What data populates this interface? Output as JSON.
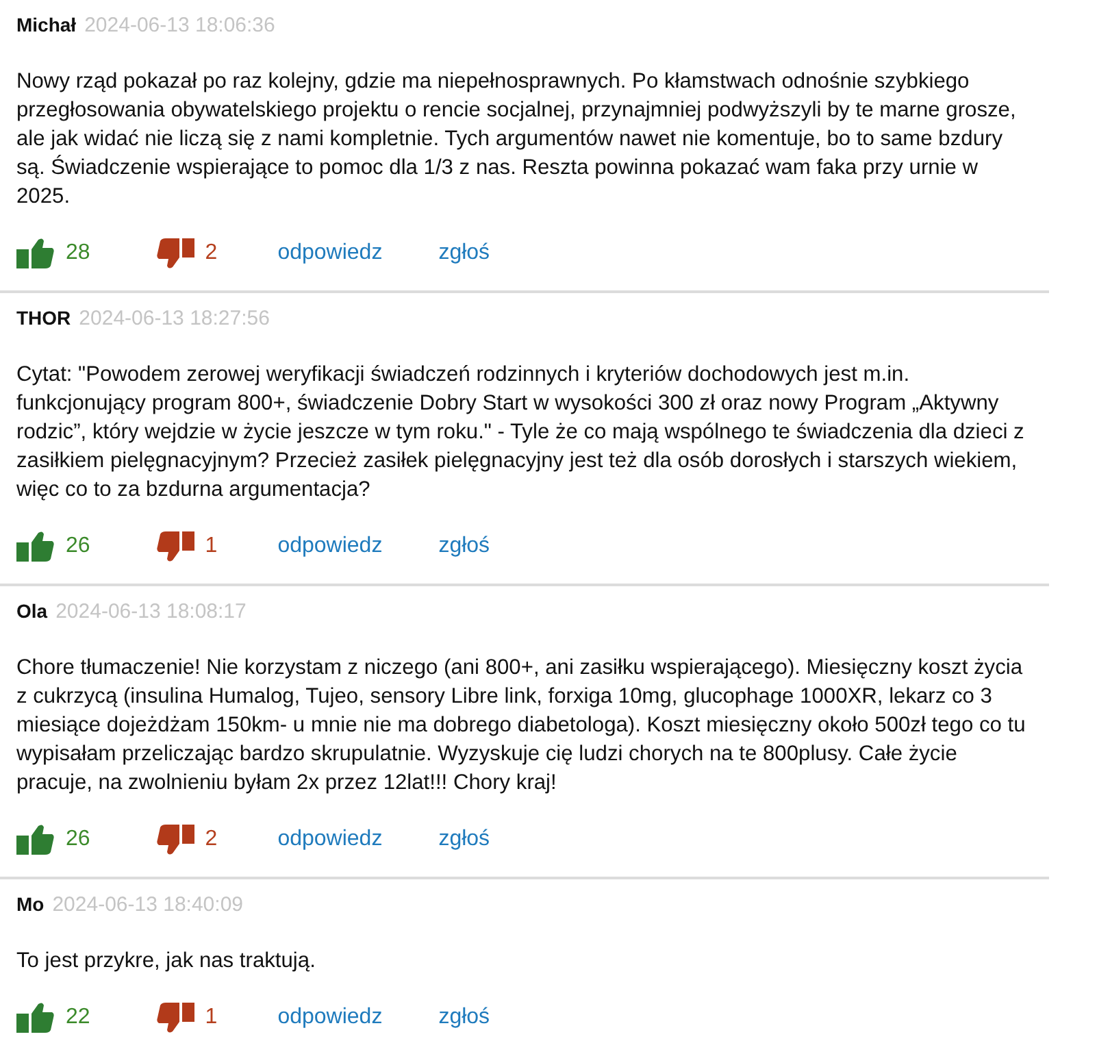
{
  "comments": [
    {
      "author": "Michał",
      "date": "2024-06-13 18:06:36",
      "text": "Nowy rząd pokazał po raz kolejny, gdzie ma niepełnosprawnych. Po kłamstwach odnośnie szybkiego przegłosowania obywatelskiego projektu o rencie socjalnej, przynajmniej podwyższyli by te marne grosze, ale jak widać nie liczą się z nami kompletnie. Tych argumentów nawet nie komentuje, bo to same bzdury są. Świadczenie wspierające to pomoc dla 1/3 z nas. Reszta powinna pokazać wam faka przy urnie w 2025.",
      "likes": "28",
      "dislikes": "2",
      "reply": "odpowiedz",
      "report": "zgłoś"
    },
    {
      "author": "THOR",
      "date": "2024-06-13 18:27:56",
      "text": "Cytat: \"Powodem zerowej weryfikacji świadczeń rodzinnych i kryteriów dochodowych jest m.in. funkcjonujący program 800+, świadczenie Dobry Start w wysokości 300 zł oraz nowy Program „Aktywny rodzic”, który wejdzie w życie jeszcze w tym roku.\" - Tyle że co mają wspólnego te świadczenia dla dzieci z zasiłkiem pielęgnacyjnym? Przecież zasiłek pielęgnacyjny jest też dla osób dorosłych i starszych wiekiem, więc co to za bzdurna argumentacja?",
      "likes": "26",
      "dislikes": "1",
      "reply": "odpowiedz",
      "report": "zgłoś"
    },
    {
      "author": "Ola",
      "date": "2024-06-13 18:08:17",
      "text": "Chore tłumaczenie! Nie korzystam z niczego (ani 800+, ani zasiłku wspierającego). Miesięczny koszt życia z cukrzycą (insulina Humalog, Tujeo, sensory Libre link, forxiga 10mg, glucophage 1000XR, lekarz co 3 miesiące dojeżdżam 150km- u mnie nie ma dobrego diabetologa). Koszt miesięczny około 500zł tego co tu wypisałam przeliczając bardzo skrupulatnie. Wyzyskuje cię ludzi chorych na te 800plusy. Całe życie pracuje, na zwolnieniu byłam 2x przez 12lat!!! Chory kraj!",
      "likes": "26",
      "dislikes": "2",
      "reply": "odpowiedz",
      "report": "zgłoś"
    },
    {
      "author": "Mo",
      "date": "2024-06-13 18:40:09",
      "text": "To jest przykre, jak nas traktują.",
      "likes": "22",
      "dislikes": "1",
      "reply": "odpowiedz",
      "report": "zgłoś"
    }
  ]
}
